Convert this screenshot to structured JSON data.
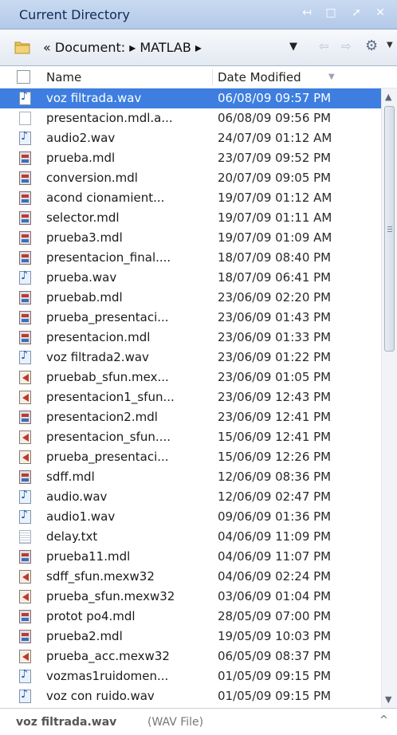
{
  "titlebar": {
    "title": "Current Directory",
    "controls": {
      "undock": "↤",
      "maximize": "□",
      "minimize": "➚",
      "close": "✕"
    }
  },
  "addressbar": {
    "path": "« Document: ▸ MATLAB ▸",
    "dropdown": "▼",
    "back": "⇦",
    "forward": "⇨",
    "gear": "⚙",
    "gear_dropdown": "▼"
  },
  "columns": {
    "name": "Name",
    "date": "Date Modified",
    "sort_indicator": "▼"
  },
  "files": [
    {
      "name": "voz filtrada.wav",
      "date": "06/08/09 09:57 PM",
      "icon": "wav",
      "selected": true
    },
    {
      "name": "presentacion.mdl.a...",
      "date": "06/08/09 09:56 PM",
      "icon": "doc"
    },
    {
      "name": "audio2.wav",
      "date": "24/07/09 01:12 AM",
      "icon": "wav"
    },
    {
      "name": "prueba.mdl",
      "date": "23/07/09 09:52 PM",
      "icon": "mdl"
    },
    {
      "name": "conversion.mdl",
      "date": "20/07/09 09:05 PM",
      "icon": "mdl"
    },
    {
      "name": "acond cionamient...",
      "date": "19/07/09 01:12 AM",
      "icon": "mdl"
    },
    {
      "name": "selector.mdl",
      "date": "19/07/09 01:11 AM",
      "icon": "mdl"
    },
    {
      "name": "prueba3.mdl",
      "date": "19/07/09 01:09 AM",
      "icon": "mdl"
    },
    {
      "name": "presentacion_final....",
      "date": "18/07/09 08:40 PM",
      "icon": "mdl"
    },
    {
      "name": "prueba.wav",
      "date": "18/07/09 06:41 PM",
      "icon": "wav"
    },
    {
      "name": "pruebab.mdl",
      "date": "23/06/09 02:20 PM",
      "icon": "mdl"
    },
    {
      "name": "prueba_presentaci...",
      "date": "23/06/09 01:43 PM",
      "icon": "mdl"
    },
    {
      "name": "presentacion.mdl",
      "date": "23/06/09 01:33 PM",
      "icon": "mdl"
    },
    {
      "name": "voz filtrada2.wav",
      "date": "23/06/09 01:22 PM",
      "icon": "wav"
    },
    {
      "name": "pruebab_sfun.mex...",
      "date": "23/06/09 01:05 PM",
      "icon": "mex"
    },
    {
      "name": "presentacion1_sfun...",
      "date": "23/06/09 12:43 PM",
      "icon": "mex"
    },
    {
      "name": "presentacion2.mdl",
      "date": "23/06/09 12:41 PM",
      "icon": "mdl"
    },
    {
      "name": "presentacion_sfun....",
      "date": "15/06/09 12:41 PM",
      "icon": "mex"
    },
    {
      "name": "prueba_presentaci...",
      "date": "15/06/09 12:26 PM",
      "icon": "mex"
    },
    {
      "name": "sdff.mdl",
      "date": "12/06/09 08:36 PM",
      "icon": "mdl"
    },
    {
      "name": "audio.wav",
      "date": "12/06/09 02:47 PM",
      "icon": "wav"
    },
    {
      "name": "audio1.wav",
      "date": "09/06/09 01:36 PM",
      "icon": "wav"
    },
    {
      "name": "delay.txt",
      "date": "04/06/09 11:09 PM",
      "icon": "txt"
    },
    {
      "name": "prueba11.mdl",
      "date": "04/06/09 11:07 PM",
      "icon": "mdl"
    },
    {
      "name": "sdff_sfun.mexw32",
      "date": "04/06/09 02:24 PM",
      "icon": "mex"
    },
    {
      "name": "prueba_sfun.mexw32",
      "date": "03/06/09 01:04 PM",
      "icon": "mex"
    },
    {
      "name": "protot po4.mdl",
      "date": "28/05/09 07:00 PM",
      "icon": "mdl"
    },
    {
      "name": "prueba2.mdl",
      "date": "19/05/09 10:03 PM",
      "icon": "mdl"
    },
    {
      "name": "prueba_acc.mexw32",
      "date": "06/05/09 08:37 PM",
      "icon": "mex"
    },
    {
      "name": "vozmas1ruidomen...",
      "date": "01/05/09 09:15 PM",
      "icon": "wav"
    },
    {
      "name": "voz con ruido.wav",
      "date": "01/05/09 09:15 PM",
      "icon": "wav"
    }
  ],
  "scrollbar": {
    "up": "▲",
    "down": "▼"
  },
  "status": {
    "name": "voz filtrada.wav",
    "type": "(WAV File)",
    "collapse": "^"
  }
}
